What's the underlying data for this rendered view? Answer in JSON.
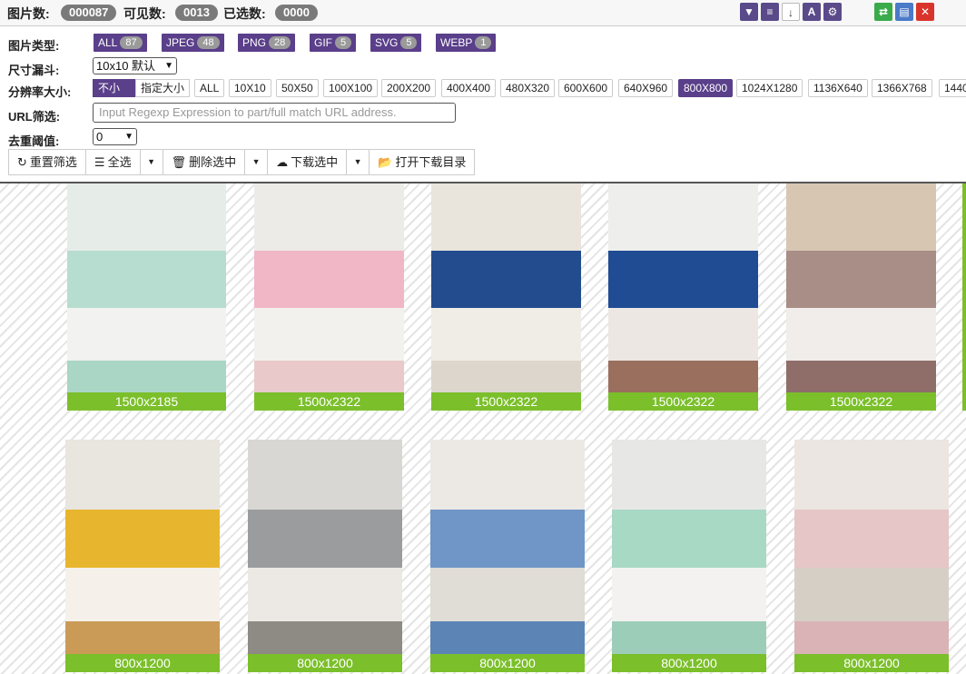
{
  "stats": {
    "total_label": "图片数:",
    "total_value": "000087",
    "visible_label": "可见数:",
    "visible_value": "0013",
    "selected_label": "已选数:",
    "selected_value": "0000"
  },
  "toolbar_icons": [
    "filter-icon",
    "list-icon",
    "sort-icon",
    "font-icon",
    "settings-icon",
    "swap-icon",
    "document-icon",
    "close-icon"
  ],
  "filters": {
    "type_label": "图片类型:",
    "types": [
      {
        "name": "ALL",
        "count": "87"
      },
      {
        "name": "JPEG",
        "count": "48"
      },
      {
        "name": "PNG",
        "count": "28"
      },
      {
        "name": "GIF",
        "count": "5"
      },
      {
        "name": "SVG",
        "count": "5"
      },
      {
        "name": "WEBP",
        "count": "1"
      }
    ],
    "funnel_label": "尺寸漏斗:",
    "funnel_value": "10x10 默认",
    "resolution_label": "分辨率大小:",
    "mode_options": [
      "不小于",
      "指定大小"
    ],
    "resolutions": [
      "ALL",
      "10X10",
      "50X50",
      "100X100",
      "200X200",
      "400X400",
      "480X320",
      "600X600",
      "640X960",
      "800X800",
      "1024X1280",
      "1136X640",
      "1366X768",
      "1440"
    ],
    "active_resolution": "800X800",
    "url_label": "URL筛选:",
    "url_placeholder": "Input Regexp Expression to part/full match URL address.",
    "dedupe_label": "去重阈值:",
    "dedupe_value": "0"
  },
  "actions": {
    "reset": "重置筛选",
    "select_all": "全选",
    "delete_selected": "删除选中",
    "download_selected": "下载选中",
    "open_folder": "打开下载目录"
  },
  "images": {
    "row1": [
      "1500x2185",
      "1500x2322",
      "1500x2322",
      "1500x2322",
      "1500x2322"
    ],
    "row2": [
      "800x1200",
      "800x1200",
      "800x1200",
      "800x1200",
      "800x1200"
    ]
  },
  "colors": {
    "accent_purple": "#5a3f8a",
    "label_green": "#7bbf2a",
    "pill_gray": "#7a7a7a"
  }
}
